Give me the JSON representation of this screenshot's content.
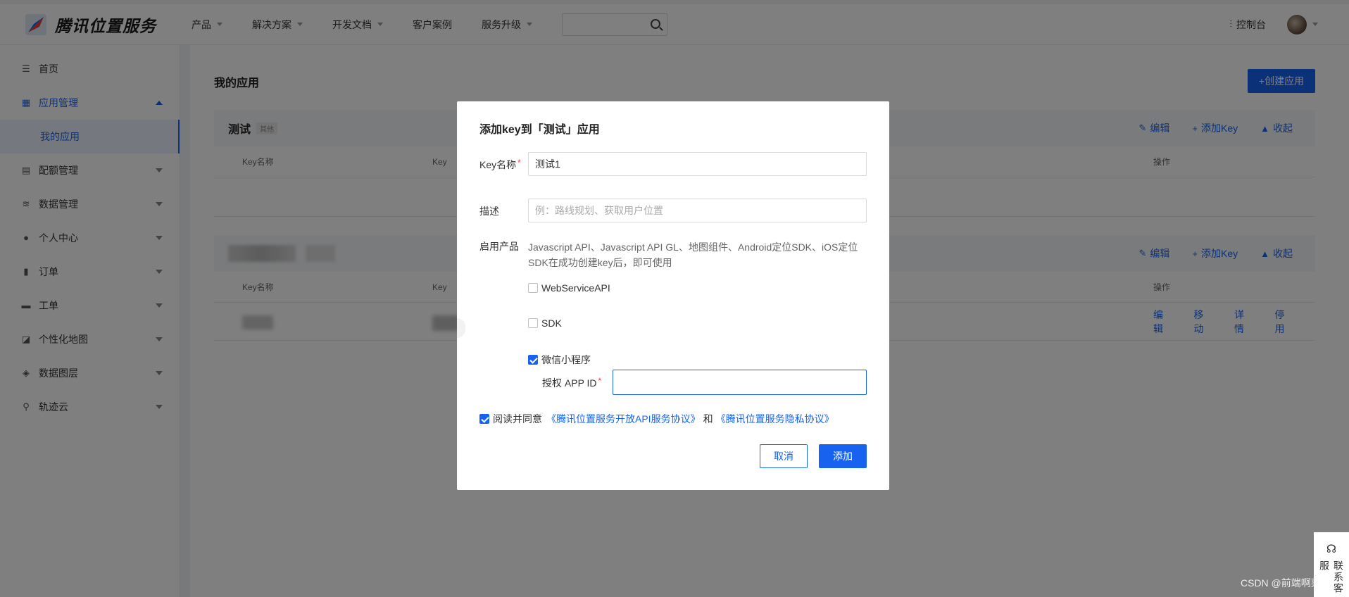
{
  "brand": {
    "name": "腾讯位置服务"
  },
  "nav": {
    "items": [
      "产品",
      "解决方案",
      "开发文档",
      "客户案例",
      "服务升级"
    ],
    "console": "控制台"
  },
  "sidebar": {
    "home": "首页",
    "app_mgmt": "应用管理",
    "my_apps": "我的应用",
    "quota": "配额管理",
    "data_mgmt": "数据管理",
    "personal": "个人中心",
    "orders": "订单",
    "tickets": "工单",
    "custom_map": "个性化地图",
    "data_layer": "数据图层",
    "track_cloud": "轨迹云"
  },
  "main": {
    "title": "我的应用",
    "create_btn": "+创建应用",
    "app1": {
      "name": "测试",
      "tag": "其他"
    },
    "actions": {
      "edit": "编辑",
      "add_key": "添加Key",
      "collapse": "收起"
    },
    "cols": {
      "key_name": "Key名称",
      "key": "Key",
      "ops": "操作"
    },
    "row_ops": {
      "edit": "编辑",
      "move": "移动",
      "detail": "详情",
      "disable": "停用"
    }
  },
  "dialog": {
    "title": "添加key到「测试」应用",
    "key_name_label": "Key名称",
    "key_name_value": "测试1",
    "desc_label": "描述",
    "desc_placeholder": "例：路线规划、获取用户位置",
    "products_label": "启用产品",
    "products_desc": "Javascript API、Javascript API GL、地图组件、Android定位SDK、iOS定位SDK在成功创建key后，即可使用",
    "opt_ws": "WebServiceAPI",
    "opt_sdk": "SDK",
    "opt_wx": "微信小程序",
    "appid_label": "授权 APP ID",
    "agree_text": "阅读并同意",
    "agree_link1": "《腾讯位置服务开放API服务协议》",
    "agree_and": "和",
    "agree_link2": "《腾讯位置服务隐私协议》",
    "cancel": "取消",
    "add": "添加"
  },
  "footer": {
    "watermark": "CSDN @前端啊菜",
    "service": "联系客服"
  },
  "colors": {
    "accent": "#1763f0",
    "required": "#e54545",
    "overlay": "rgba(0,0,0,0.5)"
  }
}
